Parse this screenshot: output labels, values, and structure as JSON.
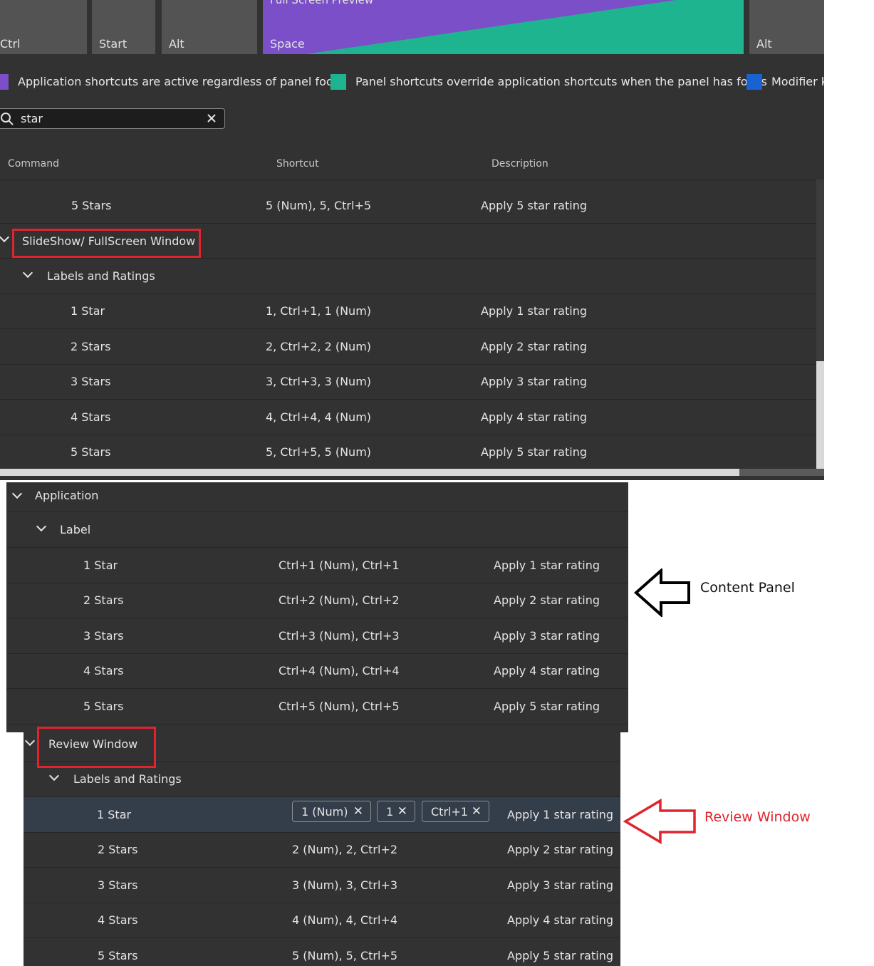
{
  "keys": {
    "k1": "Ctrl",
    "k2": "Start",
    "k3": "Alt",
    "k4_label": "Full Screen Preview",
    "k4": "Space",
    "k5": "Alt"
  },
  "legend": [
    {
      "label": "Application shortcuts are active regardless of panel focus",
      "color": "#7b4fc8"
    },
    {
      "label": "Panel shortcuts override application shortcuts when the panel has focus",
      "color": "#1fb490"
    },
    {
      "label": "Modifier k",
      "color": "#1862d2"
    }
  ],
  "search": {
    "value": "star",
    "icon": "search-icon",
    "clear_icon": "close-icon"
  },
  "columns": {
    "command": "Command",
    "shortcut": "Shortcut",
    "description": "Description"
  },
  "top_rows": {
    "r0": {
      "command": "5 Stars",
      "shortcut": "5 (Num), 5, Ctrl+5",
      "description": "Apply 5 star rating"
    },
    "group": "SlideShow/ FullScreen Window",
    "subgroup": "Labels and Ratings",
    "items": [
      {
        "command": "1 Star",
        "shortcut": "1, Ctrl+1, 1 (Num)",
        "description": "Apply 1 star rating"
      },
      {
        "command": "2 Stars",
        "shortcut": "2, Ctrl+2, 2 (Num)",
        "description": "Apply 2 star rating"
      },
      {
        "command": "3 Stars",
        "shortcut": "3, Ctrl+3, 3 (Num)",
        "description": "Apply 3 star rating"
      },
      {
        "command": "4 Stars",
        "shortcut": "4, Ctrl+4, 4 (Num)",
        "description": "Apply 4 star rating"
      },
      {
        "command": "5 Stars",
        "shortcut": "5, Ctrl+5, 5 (Num)",
        "description": "Apply 5 star rating"
      }
    ]
  },
  "content_panel": {
    "group": "Application",
    "subgroup": "Label",
    "items": [
      {
        "command": "1 Star",
        "shortcut": "Ctrl+1 (Num), Ctrl+1",
        "description": "Apply 1 star rating"
      },
      {
        "command": "2 Stars",
        "shortcut": "Ctrl+2 (Num), Ctrl+2",
        "description": "Apply 2 star rating"
      },
      {
        "command": "3 Stars",
        "shortcut": "Ctrl+3 (Num), Ctrl+3",
        "description": "Apply 3 star rating"
      },
      {
        "command": "4 Stars",
        "shortcut": "Ctrl+4 (Num), Ctrl+4",
        "description": "Apply 4 star rating"
      },
      {
        "command": "5 Stars",
        "shortcut": "Ctrl+5 (Num), Ctrl+5",
        "description": "Apply 5 star rating"
      }
    ],
    "annotation": "Content Panel"
  },
  "review_panel": {
    "group": "Review Window",
    "subgroup": "Labels and Ratings",
    "selected": {
      "command": "1 Star",
      "tags": [
        "1 (Num)",
        "1",
        "Ctrl+1"
      ],
      "description": "Apply 1 star rating"
    },
    "items": [
      {
        "command": "2 Stars",
        "shortcut": "2 (Num), 2, Ctrl+2",
        "description": "Apply 2 star rating"
      },
      {
        "command": "3 Stars",
        "shortcut": "3 (Num), 3, Ctrl+3",
        "description": "Apply 3 star rating"
      },
      {
        "command": "4 Stars",
        "shortcut": "4 (Num), 4, Ctrl+4",
        "description": "Apply 4 star rating"
      },
      {
        "command": "5 Stars",
        "shortcut": "5 (Num), 5, Ctrl+5",
        "description": "Apply 5 star rating"
      }
    ],
    "annotation": "Review Window"
  },
  "colors": {
    "annotation_red": "#e0232c",
    "panel_bg": "#323232",
    "selected_row": "#343d4a"
  }
}
